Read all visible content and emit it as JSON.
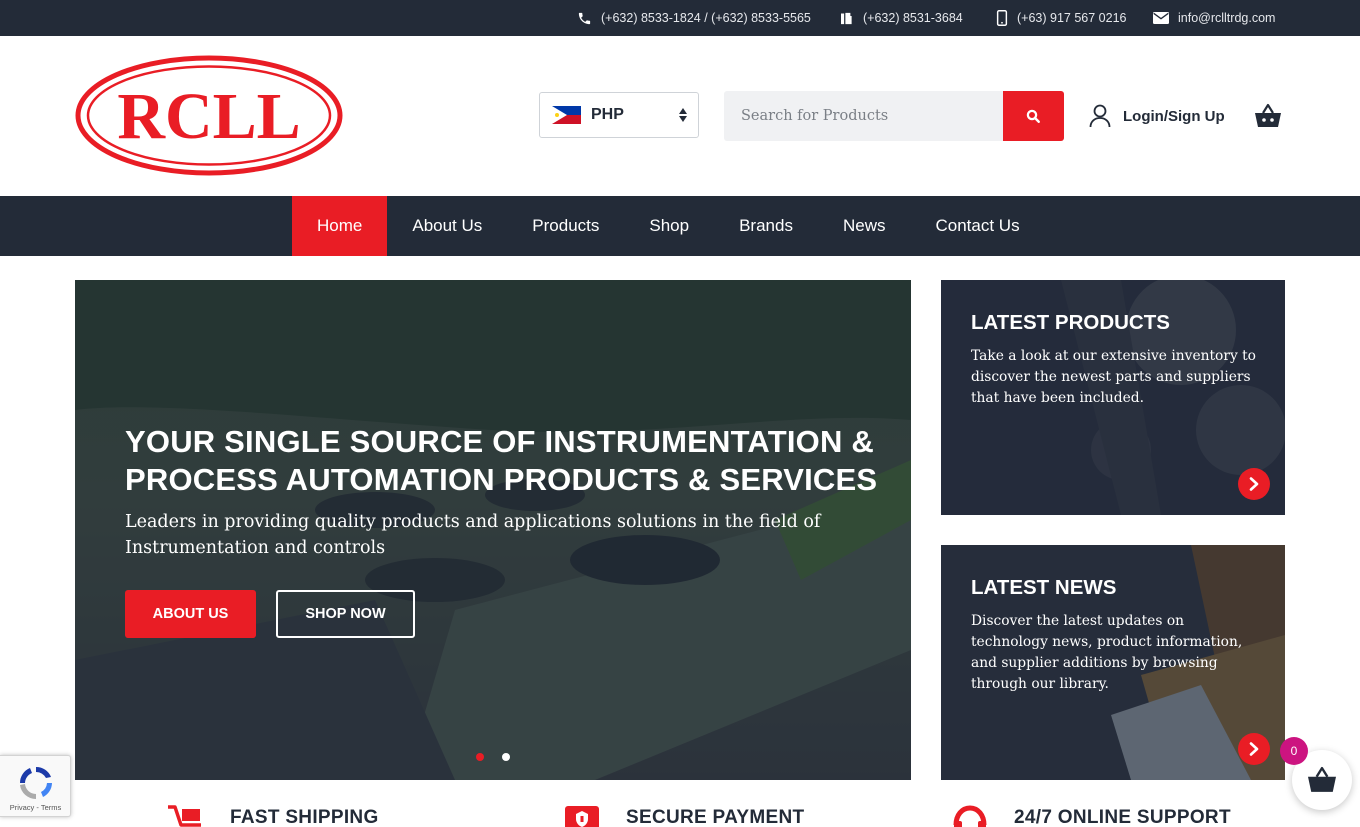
{
  "topbar": {
    "phone": "(+632) 8533-1824 / (+632) 8533-5565",
    "fax": "(+632) 8531-3684",
    "mobile": "(+63) 917 567 0216",
    "email": "info@rclltrdg.com",
    "icons": [
      "phone-icon",
      "fax-icon",
      "mobile-icon",
      "email-icon"
    ]
  },
  "header": {
    "logo_text": "RCLL",
    "currency": {
      "selected": "PHP",
      "flag": "philippines-flag-icon"
    },
    "search": {
      "placeholder": "Search for Products"
    },
    "login_label": "Login/Sign Up"
  },
  "nav": {
    "items": [
      {
        "label": "Home",
        "active": true
      },
      {
        "label": "About Us"
      },
      {
        "label": "Products"
      },
      {
        "label": "Shop"
      },
      {
        "label": "Brands"
      },
      {
        "label": "News"
      },
      {
        "label": "Contact Us"
      }
    ]
  },
  "hero": {
    "title": "YOUR SINGLE SOURCE OF INSTRUMENTATION & PROCESS AUTOMATION PRODUCTS & SERVICES",
    "subtitle": "Leaders in providing quality products and applications solutions in the field of Instrumentation and controls",
    "primary_button": "ABOUT US",
    "secondary_button": "SHOP NOW",
    "slides": 2,
    "active_slide": 1
  },
  "cards": [
    {
      "title": "LATEST PRODUCTS",
      "text": "Take a look at our extensive inventory to discover the newest parts and suppliers that have been included."
    },
    {
      "title": "LATEST NEWS",
      "text": "Discover the latest updates on technology news, product information, and supplier additions by browsing through our library."
    }
  ],
  "features": [
    {
      "label": "FAST SHIPPING",
      "icon": "shipping-cart-icon"
    },
    {
      "label": "SECURE PAYMENT",
      "icon": "secure-shield-icon"
    },
    {
      "label": "24/7 ONLINE SUPPORT",
      "icon": "support-headset-icon"
    }
  ],
  "recaptcha": {
    "terms": "Privacy - Terms"
  },
  "floating_cart": {
    "count": "0"
  },
  "colors": {
    "brand_red": "#e91d25",
    "navy": "#232b38",
    "badge": "#cc1480"
  }
}
